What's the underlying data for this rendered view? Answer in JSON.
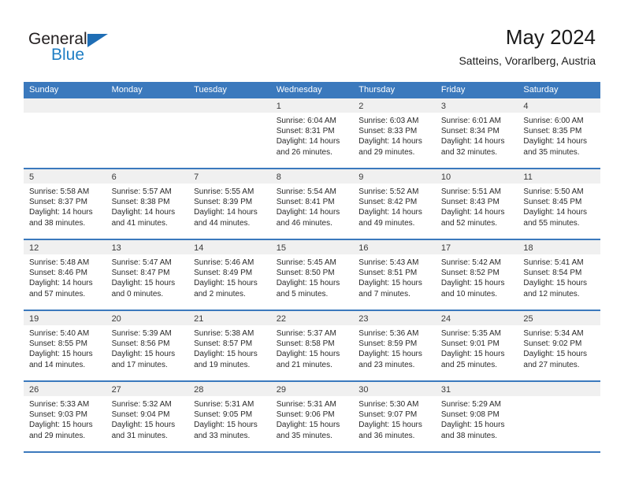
{
  "brand": {
    "name_part1": "General",
    "name_part2": "Blue",
    "triangle_color": "#1f6eb5",
    "blue_color": "#1f7ec4"
  },
  "header": {
    "title": "May 2024",
    "subtitle": "Satteins, Vorarlberg, Austria"
  },
  "theme": {
    "header_row_bg": "#3b79bd",
    "day_head_bg": "#f0f0f0",
    "week_divider": "#3b79bd"
  },
  "weekdays": [
    "Sunday",
    "Monday",
    "Tuesday",
    "Wednesday",
    "Thursday",
    "Friday",
    "Saturday"
  ],
  "labels": {
    "sunrise_prefix": "Sunrise: ",
    "sunset_prefix": "Sunset: ",
    "daylight_prefix": "Daylight: "
  },
  "weeks": [
    [
      {
        "day": "",
        "sunrise": "",
        "sunset": "",
        "daylight_line1": "",
        "daylight_line2": ""
      },
      {
        "day": "",
        "sunrise": "",
        "sunset": "",
        "daylight_line1": "",
        "daylight_line2": ""
      },
      {
        "day": "",
        "sunrise": "",
        "sunset": "",
        "daylight_line1": "",
        "daylight_line2": ""
      },
      {
        "day": "1",
        "sunrise": "Sunrise: 6:04 AM",
        "sunset": "Sunset: 8:31 PM",
        "daylight_line1": "Daylight: 14 hours",
        "daylight_line2": "and 26 minutes."
      },
      {
        "day": "2",
        "sunrise": "Sunrise: 6:03 AM",
        "sunset": "Sunset: 8:33 PM",
        "daylight_line1": "Daylight: 14 hours",
        "daylight_line2": "and 29 minutes."
      },
      {
        "day": "3",
        "sunrise": "Sunrise: 6:01 AM",
        "sunset": "Sunset: 8:34 PM",
        "daylight_line1": "Daylight: 14 hours",
        "daylight_line2": "and 32 minutes."
      },
      {
        "day": "4",
        "sunrise": "Sunrise: 6:00 AM",
        "sunset": "Sunset: 8:35 PM",
        "daylight_line1": "Daylight: 14 hours",
        "daylight_line2": "and 35 minutes."
      }
    ],
    [
      {
        "day": "5",
        "sunrise": "Sunrise: 5:58 AM",
        "sunset": "Sunset: 8:37 PM",
        "daylight_line1": "Daylight: 14 hours",
        "daylight_line2": "and 38 minutes."
      },
      {
        "day": "6",
        "sunrise": "Sunrise: 5:57 AM",
        "sunset": "Sunset: 8:38 PM",
        "daylight_line1": "Daylight: 14 hours",
        "daylight_line2": "and 41 minutes."
      },
      {
        "day": "7",
        "sunrise": "Sunrise: 5:55 AM",
        "sunset": "Sunset: 8:39 PM",
        "daylight_line1": "Daylight: 14 hours",
        "daylight_line2": "and 44 minutes."
      },
      {
        "day": "8",
        "sunrise": "Sunrise: 5:54 AM",
        "sunset": "Sunset: 8:41 PM",
        "daylight_line1": "Daylight: 14 hours",
        "daylight_line2": "and 46 minutes."
      },
      {
        "day": "9",
        "sunrise": "Sunrise: 5:52 AM",
        "sunset": "Sunset: 8:42 PM",
        "daylight_line1": "Daylight: 14 hours",
        "daylight_line2": "and 49 minutes."
      },
      {
        "day": "10",
        "sunrise": "Sunrise: 5:51 AM",
        "sunset": "Sunset: 8:43 PM",
        "daylight_line1": "Daylight: 14 hours",
        "daylight_line2": "and 52 minutes."
      },
      {
        "day": "11",
        "sunrise": "Sunrise: 5:50 AM",
        "sunset": "Sunset: 8:45 PM",
        "daylight_line1": "Daylight: 14 hours",
        "daylight_line2": "and 55 minutes."
      }
    ],
    [
      {
        "day": "12",
        "sunrise": "Sunrise: 5:48 AM",
        "sunset": "Sunset: 8:46 PM",
        "daylight_line1": "Daylight: 14 hours",
        "daylight_line2": "and 57 minutes."
      },
      {
        "day": "13",
        "sunrise": "Sunrise: 5:47 AM",
        "sunset": "Sunset: 8:47 PM",
        "daylight_line1": "Daylight: 15 hours",
        "daylight_line2": "and 0 minutes."
      },
      {
        "day": "14",
        "sunrise": "Sunrise: 5:46 AM",
        "sunset": "Sunset: 8:49 PM",
        "daylight_line1": "Daylight: 15 hours",
        "daylight_line2": "and 2 minutes."
      },
      {
        "day": "15",
        "sunrise": "Sunrise: 5:45 AM",
        "sunset": "Sunset: 8:50 PM",
        "daylight_line1": "Daylight: 15 hours",
        "daylight_line2": "and 5 minutes."
      },
      {
        "day": "16",
        "sunrise": "Sunrise: 5:43 AM",
        "sunset": "Sunset: 8:51 PM",
        "daylight_line1": "Daylight: 15 hours",
        "daylight_line2": "and 7 minutes."
      },
      {
        "day": "17",
        "sunrise": "Sunrise: 5:42 AM",
        "sunset": "Sunset: 8:52 PM",
        "daylight_line1": "Daylight: 15 hours",
        "daylight_line2": "and 10 minutes."
      },
      {
        "day": "18",
        "sunrise": "Sunrise: 5:41 AM",
        "sunset": "Sunset: 8:54 PM",
        "daylight_line1": "Daylight: 15 hours",
        "daylight_line2": "and 12 minutes."
      }
    ],
    [
      {
        "day": "19",
        "sunrise": "Sunrise: 5:40 AM",
        "sunset": "Sunset: 8:55 PM",
        "daylight_line1": "Daylight: 15 hours",
        "daylight_line2": "and 14 minutes."
      },
      {
        "day": "20",
        "sunrise": "Sunrise: 5:39 AM",
        "sunset": "Sunset: 8:56 PM",
        "daylight_line1": "Daylight: 15 hours",
        "daylight_line2": "and 17 minutes."
      },
      {
        "day": "21",
        "sunrise": "Sunrise: 5:38 AM",
        "sunset": "Sunset: 8:57 PM",
        "daylight_line1": "Daylight: 15 hours",
        "daylight_line2": "and 19 minutes."
      },
      {
        "day": "22",
        "sunrise": "Sunrise: 5:37 AM",
        "sunset": "Sunset: 8:58 PM",
        "daylight_line1": "Daylight: 15 hours",
        "daylight_line2": "and 21 minutes."
      },
      {
        "day": "23",
        "sunrise": "Sunrise: 5:36 AM",
        "sunset": "Sunset: 8:59 PM",
        "daylight_line1": "Daylight: 15 hours",
        "daylight_line2": "and 23 minutes."
      },
      {
        "day": "24",
        "sunrise": "Sunrise: 5:35 AM",
        "sunset": "Sunset: 9:01 PM",
        "daylight_line1": "Daylight: 15 hours",
        "daylight_line2": "and 25 minutes."
      },
      {
        "day": "25",
        "sunrise": "Sunrise: 5:34 AM",
        "sunset": "Sunset: 9:02 PM",
        "daylight_line1": "Daylight: 15 hours",
        "daylight_line2": "and 27 minutes."
      }
    ],
    [
      {
        "day": "26",
        "sunrise": "Sunrise: 5:33 AM",
        "sunset": "Sunset: 9:03 PM",
        "daylight_line1": "Daylight: 15 hours",
        "daylight_line2": "and 29 minutes."
      },
      {
        "day": "27",
        "sunrise": "Sunrise: 5:32 AM",
        "sunset": "Sunset: 9:04 PM",
        "daylight_line1": "Daylight: 15 hours",
        "daylight_line2": "and 31 minutes."
      },
      {
        "day": "28",
        "sunrise": "Sunrise: 5:31 AM",
        "sunset": "Sunset: 9:05 PM",
        "daylight_line1": "Daylight: 15 hours",
        "daylight_line2": "and 33 minutes."
      },
      {
        "day": "29",
        "sunrise": "Sunrise: 5:31 AM",
        "sunset": "Sunset: 9:06 PM",
        "daylight_line1": "Daylight: 15 hours",
        "daylight_line2": "and 35 minutes."
      },
      {
        "day": "30",
        "sunrise": "Sunrise: 5:30 AM",
        "sunset": "Sunset: 9:07 PM",
        "daylight_line1": "Daylight: 15 hours",
        "daylight_line2": "and 36 minutes."
      },
      {
        "day": "31",
        "sunrise": "Sunrise: 5:29 AM",
        "sunset": "Sunset: 9:08 PM",
        "daylight_line1": "Daylight: 15 hours",
        "daylight_line2": "and 38 minutes."
      },
      {
        "day": "",
        "sunrise": "",
        "sunset": "",
        "daylight_line1": "",
        "daylight_line2": ""
      }
    ]
  ]
}
